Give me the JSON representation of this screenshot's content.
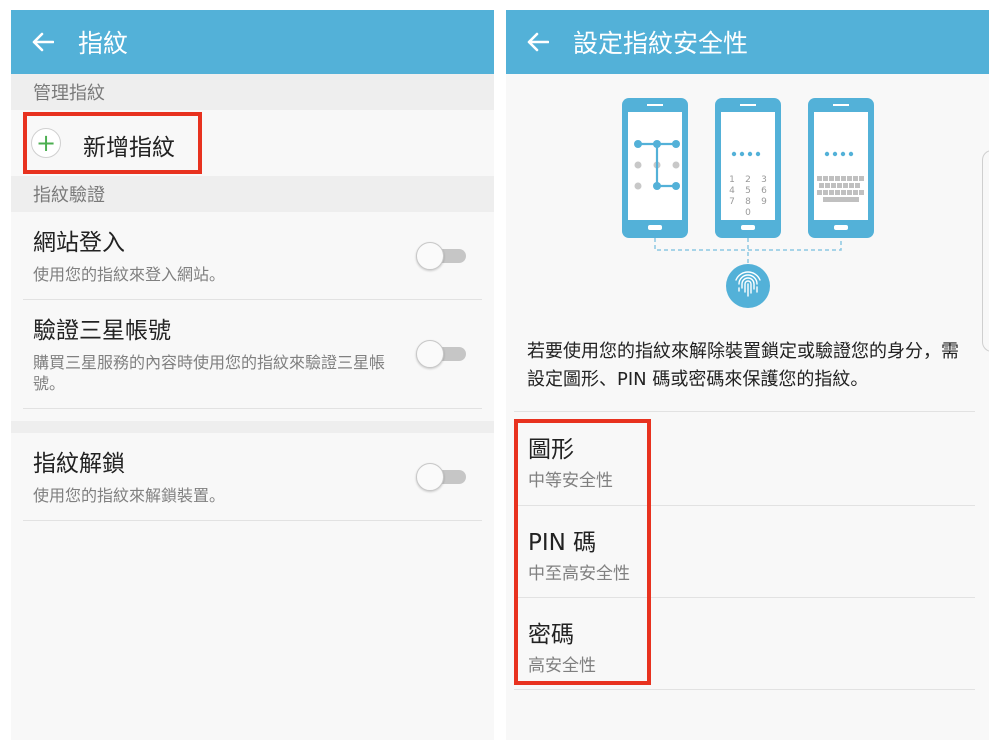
{
  "left_screen": {
    "title": "指紋",
    "manage_header": "管理指紋",
    "add_fingerprint_label": "新增指紋",
    "verify_header": "指紋驗證",
    "settings": [
      {
        "title": "網站登入",
        "description": "使用您的指紋來登入網站。",
        "enabled": false
      },
      {
        "title": "驗證三星帳號",
        "description": "購買三星服務的內容時使用您的指紋來驗證三星帳號。",
        "enabled": false
      },
      {
        "title": "指紋解鎖",
        "description": "使用您的指紋來解鎖裝置。",
        "enabled": false
      }
    ]
  },
  "right_screen": {
    "title": "設定指紋安全性",
    "illustration": {
      "phone_count": 3,
      "pin_keys": [
        "1",
        "2",
        "3",
        "4",
        "5",
        "6",
        "7",
        "8",
        "9",
        "0"
      ],
      "fingerprint_icon": "fingerprint-icon"
    },
    "description": "若要使用您的指紋來解除裝置鎖定或驗證您的身分，需設定圖形、PIN 碼或密碼來保護您的指紋。",
    "options": [
      {
        "title": "圖形",
        "security": "中等安全性"
      },
      {
        "title": "PIN 碼",
        "security": "中至高安全性"
      },
      {
        "title": "密碼",
        "security": "高安全性"
      }
    ]
  },
  "colors": {
    "appbar": "#53b1d8",
    "highlight": "#e8321f",
    "plus_icon": "#4caf50",
    "background": "#f8f8f8"
  }
}
